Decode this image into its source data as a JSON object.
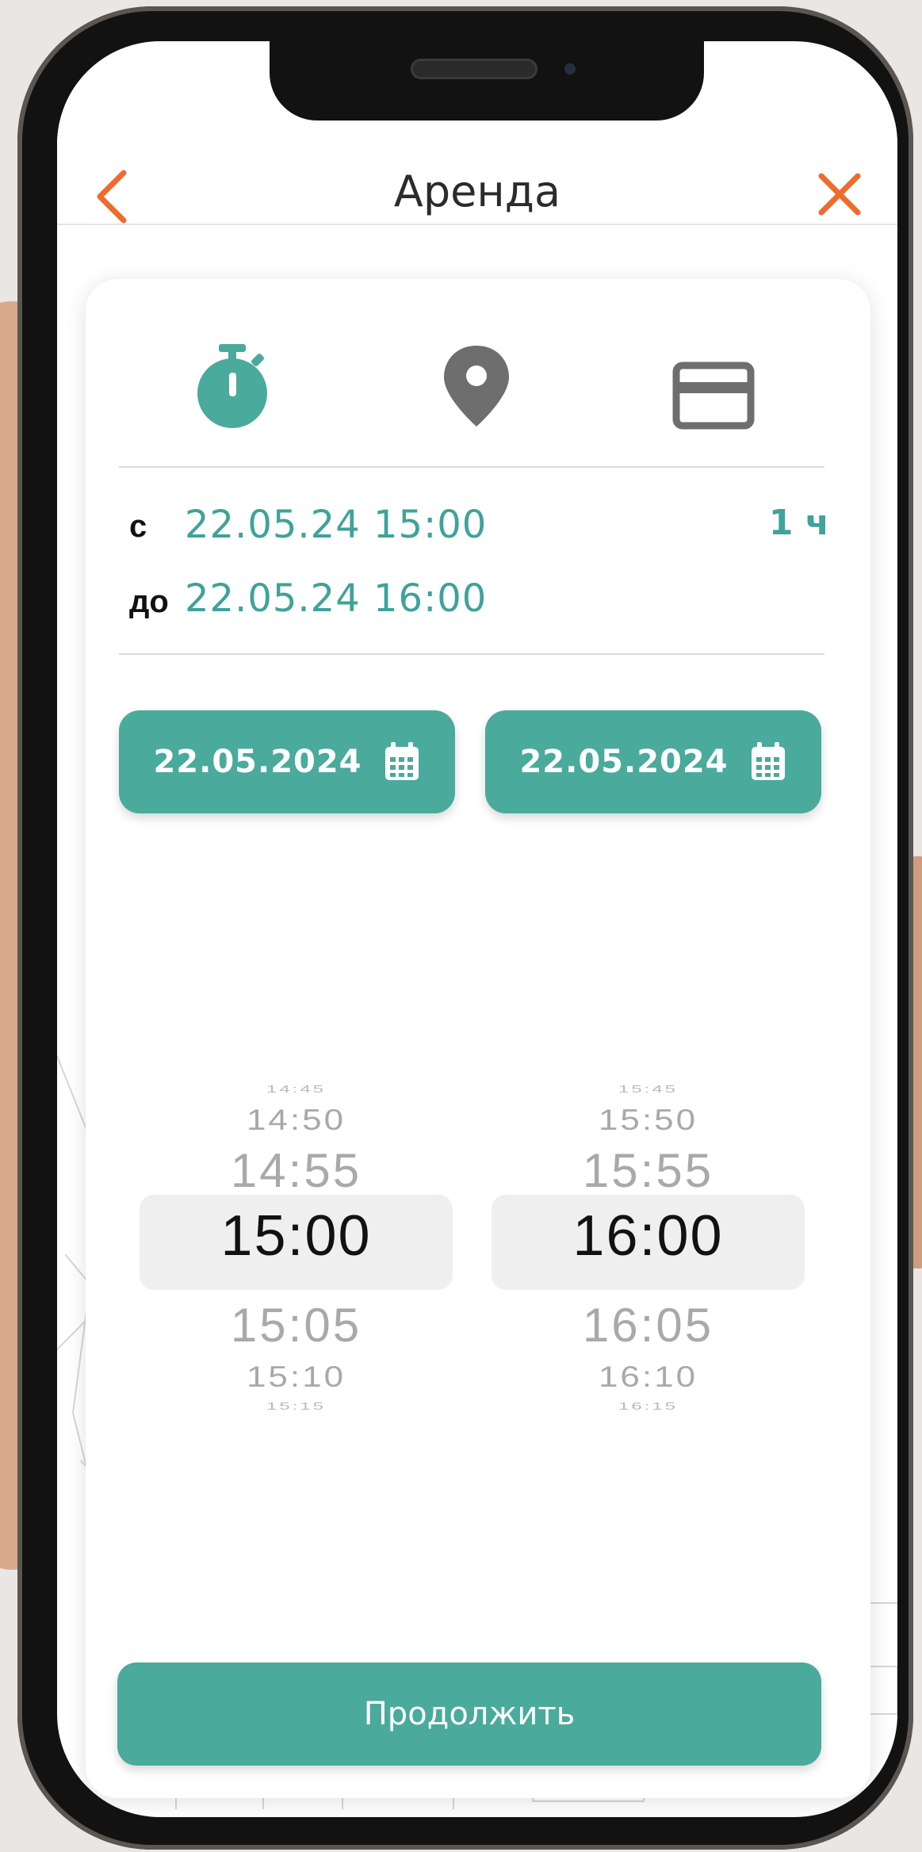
{
  "header": {
    "title": "Аренда"
  },
  "steps": [
    {
      "icon": "stopwatch-icon",
      "active": true
    },
    {
      "icon": "location-pin-icon",
      "active": false
    },
    {
      "icon": "credit-card-icon",
      "active": false
    }
  ],
  "rental": {
    "from_label": "с",
    "from_value": "22.05.24 15:00",
    "to_label": "до",
    "to_value": "22.05.24 16:00",
    "duration": "1 ч"
  },
  "date_buttons": {
    "start": "22.05.2024",
    "end": "22.05.2024"
  },
  "start_picker": {
    "items": [
      "14:45",
      "14:50",
      "14:55",
      "15:00",
      "15:05",
      "15:10",
      "15:15"
    ],
    "selected": "15:00"
  },
  "end_picker": {
    "items": [
      "15:45",
      "15:50",
      "15:55",
      "16:00",
      "16:05",
      "16:10",
      "16:15"
    ],
    "selected": "16:00"
  },
  "continue_label": "Продолжить",
  "colors": {
    "accent": "#4aaa9c",
    "accent_text": "#3ea39a",
    "nav_icons": "#ef6a2b",
    "inactive_icon": "#6e6e6e"
  }
}
